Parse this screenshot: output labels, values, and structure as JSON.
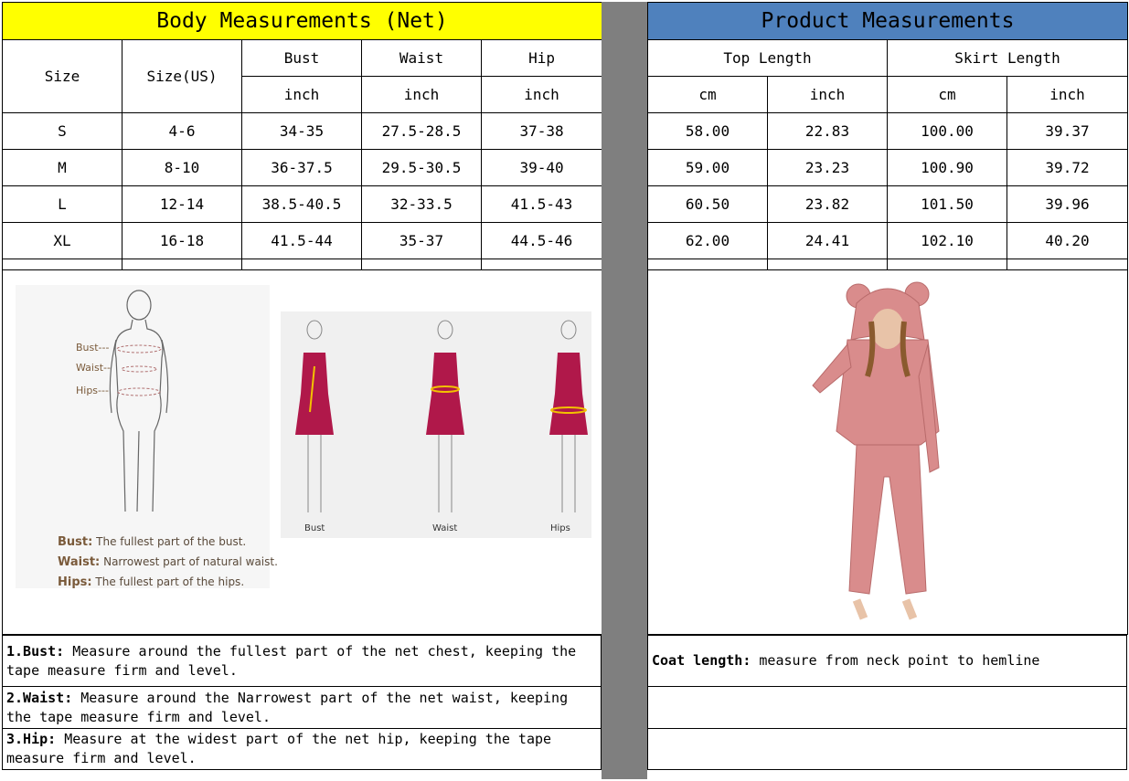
{
  "body": {
    "title": "Body Measurements (Net)",
    "col_size": "Size",
    "col_size_us": "Size(US)",
    "col_bust": "Bust",
    "col_waist": "Waist",
    "col_hip": "Hip",
    "unit": "inch",
    "rows": [
      [
        "S",
        "4-6",
        "34-35",
        "27.5-28.5",
        "37-38"
      ],
      [
        "M",
        "8-10",
        "36-37.5",
        "29.5-30.5",
        "39-40"
      ],
      [
        "L",
        "12-14",
        "38.5-40.5",
        "32-33.5",
        "41.5-43"
      ],
      [
        "XL",
        "16-18",
        "41.5-44",
        "35-37",
        "44.5-46"
      ]
    ],
    "diagram": {
      "bust": "Bust---",
      "waist": "Waist--",
      "hips": "Hips---",
      "legend": [
        {
          "term": "Bust:",
          "desc": "The fullest part of the bust."
        },
        {
          "term": "Waist:",
          "desc": "Narrowest part of natural waist."
        },
        {
          "term": "Hips:",
          "desc": "The fullest part of the hips."
        }
      ],
      "captions": [
        "Bust",
        "Waist",
        "Hips"
      ]
    },
    "notes": [
      {
        "term": "1.Bust:",
        "text": " Measure around the fullest part of the net chest, keeping the tape  measure firm and level."
      },
      {
        "term": "2.Waist:",
        "text": " Measure around the Narrowest part of the net waist, keeping the tape  measure firm and level."
      },
      {
        "term": "3.Hip:",
        "text": " Measure at the widest part of the net hip, keeping the tape measure firm and level."
      }
    ]
  },
  "product": {
    "title": "Product Measurements",
    "col_top": "Top Length",
    "col_skirt": "Skirt Length",
    "unit_cm": "cm",
    "unit_inch": "inch",
    "rows": [
      [
        "58.00",
        "22.83",
        "100.00",
        "39.37"
      ],
      [
        "59.00",
        "23.23",
        "100.90",
        "39.72"
      ],
      [
        "60.50",
        "23.82",
        "101.50",
        "39.96"
      ],
      [
        "62.00",
        "24.41",
        "102.10",
        "40.20"
      ]
    ],
    "note_term": "Coat length:",
    "note_text": " measure from neck point to hemline"
  },
  "colors": {
    "body_header": "#ffff00",
    "product_header": "#4f81bd",
    "separator": "#7f7f7f",
    "garment": "#d98c8c",
    "dress": "#b0184a"
  }
}
